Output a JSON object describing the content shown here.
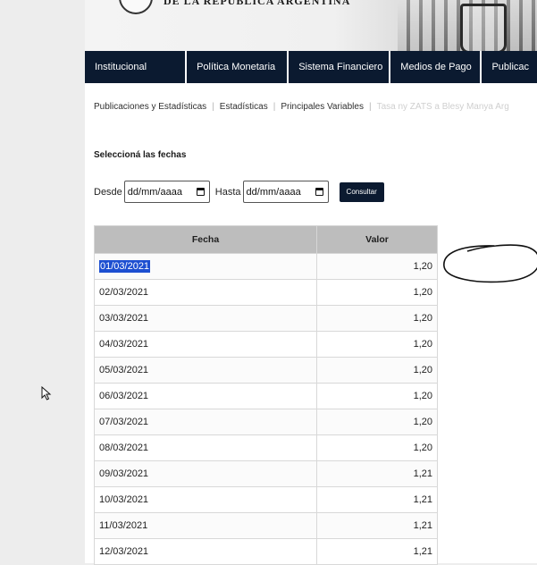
{
  "nav": {
    "items": [
      {
        "label": "Institucional",
        "width": 113
      },
      {
        "label": "Política Monetaria",
        "width": 113
      },
      {
        "label": "Sistema Financiero",
        "width": 113
      },
      {
        "label": "Medios de Pago",
        "width": 101
      },
      {
        "label": "Publicac",
        "width": 62
      }
    ]
  },
  "breadcrumb": {
    "items": [
      "Publicaciones y Estadísticas",
      "Estadísticas",
      "Principales Variables"
    ],
    "faded": "Tasa ny ZATS a Blesy Manya Arg"
  },
  "form": {
    "title": "Seleccioná las fechas",
    "from_label": "Desde",
    "from_value": "dd/mm/aaaa",
    "to_label": "Hasta",
    "to_value": "dd/mm/aaaa",
    "submit_label": "Consultar"
  },
  "table": {
    "headers": {
      "date": "Fecha",
      "value": "Valor"
    },
    "rows": [
      {
        "date": "01/03/2021",
        "value": "1,20",
        "selected": true
      },
      {
        "date": "02/03/2021",
        "value": "1,20"
      },
      {
        "date": "03/03/2021",
        "value": "1,20"
      },
      {
        "date": "04/03/2021",
        "value": "1,20"
      },
      {
        "date": "05/03/2021",
        "value": "1,20"
      },
      {
        "date": "06/03/2021",
        "value": "1,20"
      },
      {
        "date": "07/03/2021",
        "value": "1,20"
      },
      {
        "date": "08/03/2021",
        "value": "1,20"
      },
      {
        "date": "09/03/2021",
        "value": "1,21"
      },
      {
        "date": "10/03/2021",
        "value": "1,21"
      },
      {
        "date": "11/03/2021",
        "value": "1,21"
      },
      {
        "date": "12/03/2021",
        "value": "1,21"
      }
    ]
  },
  "colors": {
    "nav_bg": "#0b1a30",
    "selection": "#1d4fd1",
    "table_header": "#bdbdbd"
  },
  "icons": {
    "calendar": "calendar-icon",
    "cursor": "mouse-cursor-icon"
  }
}
